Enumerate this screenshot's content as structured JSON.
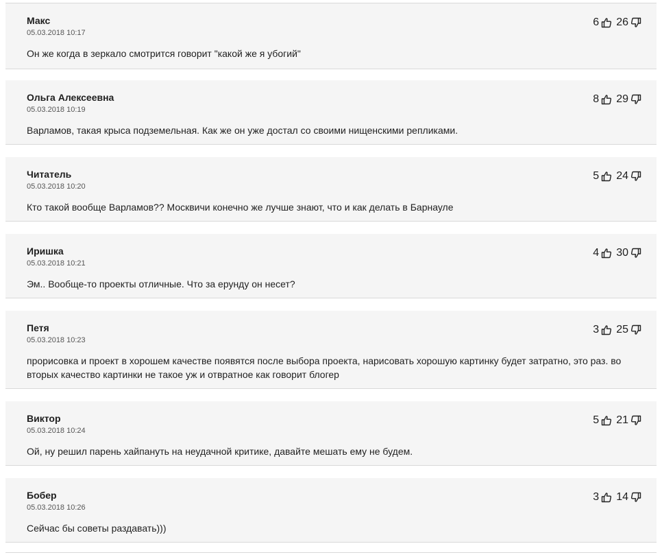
{
  "comments": [
    {
      "author": "Макс",
      "date": "05.03.2018 10:17",
      "text": "Он же когда в зеркало смотрится говорит \"какой же я убогий\"",
      "likes": "6",
      "dislikes": "26"
    },
    {
      "author": "Ольга Алексеевна",
      "date": "05.03.2018 10:19",
      "text": "Варламов, такая крыса подземельная. Как же он уже достал со своими нищенскими репликами.",
      "likes": "8",
      "dislikes": "29"
    },
    {
      "author": "Читатель",
      "date": "05.03.2018 10:20",
      "text": "Кто такой вообще Варламов?? Москвичи конечно же лучше знают, что и как делать в Барнауле",
      "likes": "5",
      "dislikes": "24"
    },
    {
      "author": "Иришка",
      "date": "05.03.2018 10:21",
      "text": "Эм.. Вообще-то проекты отличные. Что за ерунду он несет?",
      "likes": "4",
      "dislikes": "30"
    },
    {
      "author": "Петя",
      "date": "05.03.2018 10:23",
      "text": "прорисовка и проект в хорошем качестве появятся после выбора проекта, нарисовать хорошую картинку будет затратно, это раз. во вторых качество картинки не такое уж и отвратное как говорит блогер",
      "likes": "3",
      "dislikes": "25"
    },
    {
      "author": "Виктор",
      "date": "05.03.2018 10:24",
      "text": "Ой, ну решил парень хайпануть на неудачной критике, давайте мешать ему не будем.",
      "likes": "5",
      "dislikes": "21"
    },
    {
      "author": "Бобер",
      "date": "05.03.2018 10:26",
      "text": "Сейчас бы советы раздавать)))",
      "likes": "3",
      "dislikes": "14"
    }
  ],
  "icons": {
    "like": "thumbs-up-outline-icon",
    "dislike": "thumbs-down-outline-icon"
  },
  "colors": {
    "card_background": "#f5f5f5",
    "divider": "#d9d9d9",
    "text": "#1f1f1f",
    "date": "#555555"
  }
}
